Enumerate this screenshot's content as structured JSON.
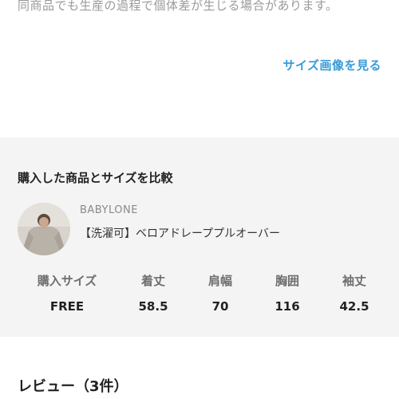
{
  "description": {
    "text": "同商品でも生産の過程で個体差が生じる場合があります。"
  },
  "size_image_link": "サイズ画像を見る",
  "compare": {
    "title": "購入した商品とサイズを比較",
    "product": {
      "brand": "BABYLONE",
      "name": "【洗濯可】ベロアドレーププルオーバー"
    },
    "table": {
      "headers": [
        "購入サイズ",
        "着丈",
        "肩幅",
        "胸囲",
        "袖丈"
      ],
      "values": [
        "FREE",
        "58.5",
        "70",
        "116",
        "42.5"
      ]
    }
  },
  "reviews_heading": "レビュー（3件）"
}
